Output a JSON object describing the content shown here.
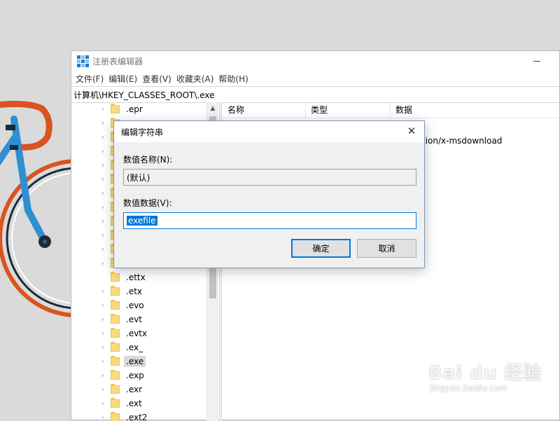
{
  "window": {
    "title": "注册表编辑器",
    "menu": [
      "文件(F)",
      "编辑(E)",
      "查看(V)",
      "收藏夹(A)",
      "帮助(H)"
    ],
    "address": "计算机\\HKEY_CLASSES_ROOT\\.exe"
  },
  "tree": {
    "items": [
      ".epr",
      "",
      "",
      "",
      "",
      "",
      "",
      "",
      "",
      "",
      "",
      "",
      ".ettx",
      ".etx",
      ".evo",
      ".evt",
      ".evtx",
      ".ex_",
      ".exe",
      ".exp",
      ".exr",
      ".ext",
      ".ext2"
    ],
    "selected": ".exe"
  },
  "list": {
    "columns": [
      "名称",
      "类型",
      "数据"
    ],
    "visible_data": "tion/x-msdownload"
  },
  "dialog": {
    "title": "编辑字符串",
    "value_name_label": "数值名称(N):",
    "value_name": "(默认)",
    "value_data_label": "数值数据(V):",
    "value_data": "exefile",
    "ok_label": "确定",
    "cancel_label": "取消"
  },
  "watermark": {
    "logo": "Bai du 经验",
    "url": "jingyan.baidu.com"
  },
  "colors": {
    "selection": "#0078d7",
    "folder": "#f9db7e",
    "bike_blue": "#2f8fd2",
    "bike_orange": "#d9541e"
  }
}
